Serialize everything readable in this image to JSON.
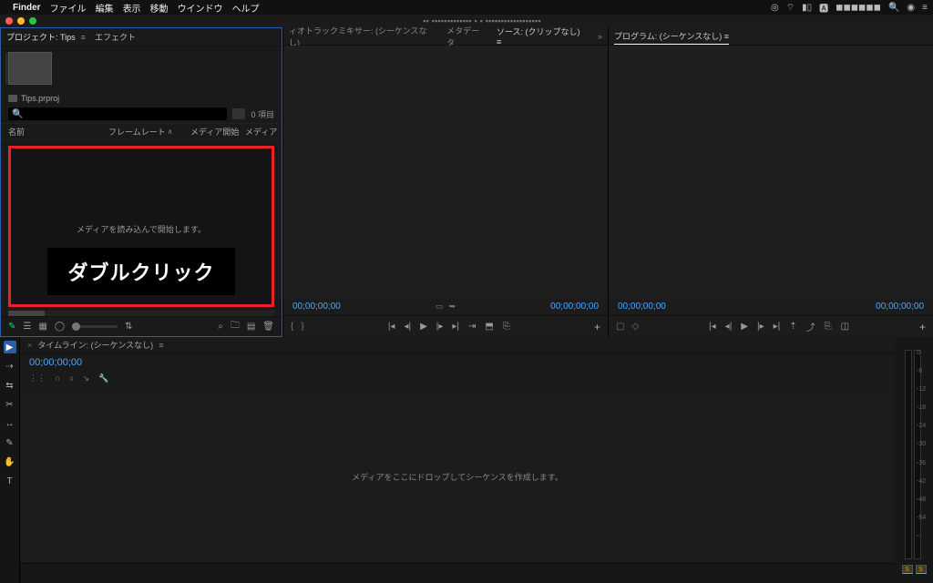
{
  "mac_bar": {
    "finder": "Finder",
    "menus": [
      "ファイル",
      "編集",
      "表示",
      "移動",
      "ウインドウ",
      "ヘルプ"
    ],
    "date_blur": "◼◼◼◼◼◼"
  },
  "window": {
    "title_blur": "▪▪ ▪▪▪▪▪▪▪▪▪▪▪▪▪ ▪ ▪ ▪▪▪▪▪▪▪▪▪▪▪▪▪▪▪▪▪▪"
  },
  "project": {
    "tab_project": "プロジェクト: Tips",
    "tab_effects": "エフェクト",
    "file_name": "Tips.prproj",
    "item_count": "0 項目",
    "col_name": "名前",
    "col_fps": "フレームレート",
    "col_media_start": "メディア開始",
    "col_media": "メディア",
    "drop_text": "メディアを読み込んで開始します。",
    "overlay": "ダブルクリック"
  },
  "source_panel": {
    "tab_mixer": "ィオトラックミキサー: (シーケンスなし)",
    "tab_metadata": "メタデータ",
    "tab_source": "ソース: (クリップなし)",
    "tc_left": "00;00;00;00",
    "tc_right": "00;00;00;00"
  },
  "program_panel": {
    "tab_program": "プログラム: (シーケンスなし)",
    "tc_left": "00;00;00;00",
    "tc_right": "00;00;00;00"
  },
  "timeline": {
    "tab": "タイムライン: (シーケンスなし)",
    "tc": "00;00;00;00",
    "drop_msg": "メディアをここにドロップしてシーケンスを作成します。"
  },
  "meters": {
    "ticks": [
      "0",
      "-6",
      "-12",
      "-18",
      "-24",
      "-30",
      "-36",
      "-42",
      "-48",
      "-54",
      "--"
    ],
    "solo": "S"
  }
}
